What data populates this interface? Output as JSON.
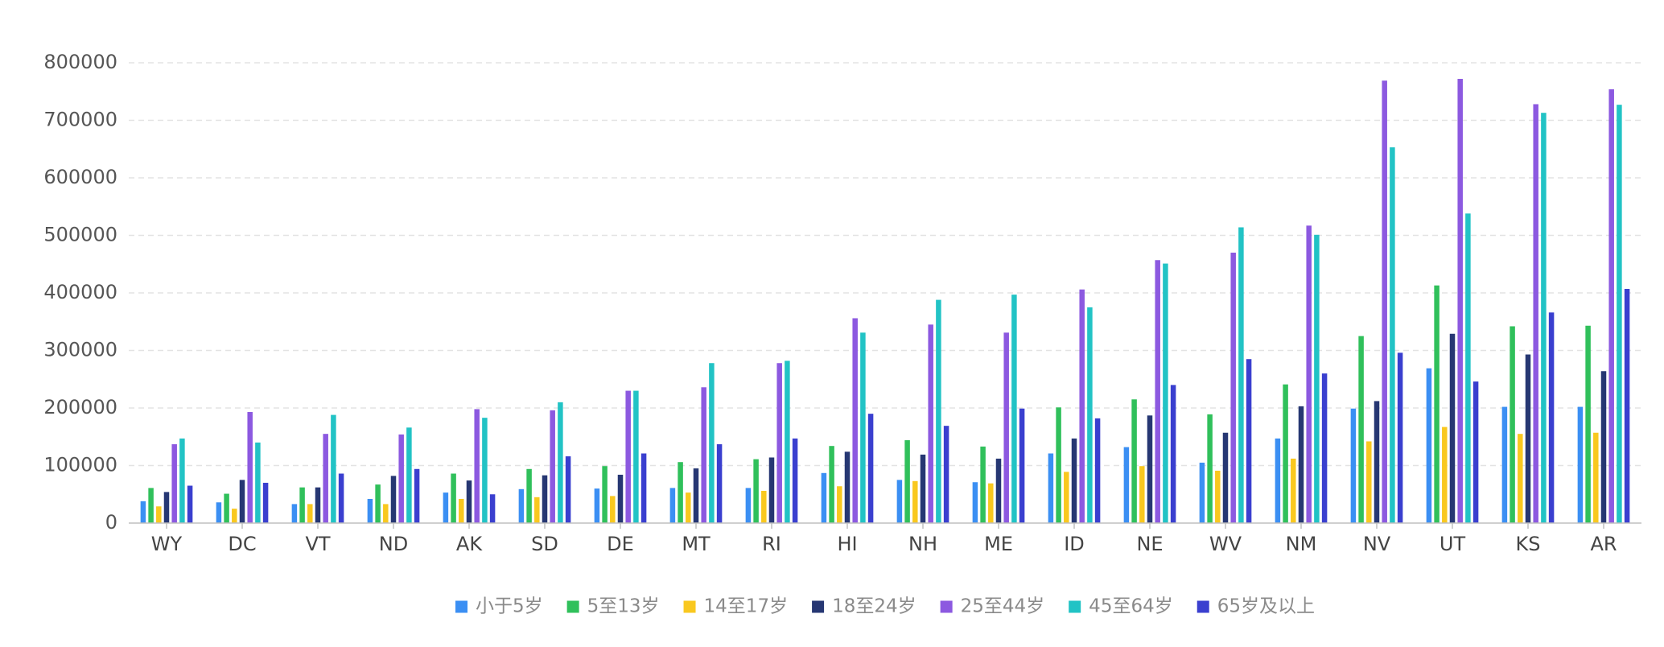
{
  "chart_data": {
    "type": "bar",
    "title": "",
    "xlabel": "",
    "ylabel": "",
    "ylim": [
      0,
      800000
    ],
    "yticks": [
      0,
      100000,
      200000,
      300000,
      400000,
      500000,
      600000,
      700000,
      800000
    ],
    "grid": "horizontal-dashed",
    "legend": "bottom-center",
    "categories": [
      "WY",
      "DC",
      "VT",
      "ND",
      "AK",
      "SD",
      "DE",
      "MT",
      "RI",
      "HI",
      "NH",
      "ME",
      "ID",
      "NE",
      "WV",
      "NM",
      "NV",
      "UT",
      "KS",
      "AR"
    ],
    "series": [
      {
        "name": "小于5岁",
        "color": "#3b8ff3",
        "values": [
          38000,
          36000,
          33000,
          42000,
          53000,
          59000,
          60000,
          61000,
          61000,
          87000,
          75000,
          71000,
          121000,
          132000,
          105000,
          147000,
          199000,
          269000,
          202000,
          202000
        ]
      },
      {
        "name": "5至13岁",
        "color": "#30c05b",
        "values": [
          61000,
          51000,
          62000,
          67000,
          86000,
          94000,
          99000,
          106000,
          111000,
          134000,
          144000,
          133000,
          201000,
          215000,
          189000,
          241000,
          325000,
          413000,
          342000,
          343000
        ]
      },
      {
        "name": "14至17岁",
        "color": "#f9c81f",
        "values": [
          29000,
          25000,
          33000,
          33000,
          42000,
          45000,
          47000,
          53000,
          56000,
          64000,
          73000,
          69000,
          89000,
          99000,
          91000,
          112000,
          142000,
          167000,
          155000,
          157000
        ]
      },
      {
        "name": "18至24岁",
        "color": "#263773",
        "values": [
          54000,
          75000,
          62000,
          82000,
          74000,
          83000,
          84000,
          95000,
          114000,
          124000,
          119000,
          112000,
          147000,
          187000,
          157000,
          203000,
          212000,
          329000,
          293000,
          264000
        ]
      },
      {
        "name": "25至44岁",
        "color": "#8c59e0",
        "values": [
          137000,
          193000,
          155000,
          154000,
          198000,
          196000,
          230000,
          236000,
          278000,
          356000,
          345000,
          331000,
          406000,
          457000,
          470000,
          517000,
          769000,
          772000,
          728000,
          754000
        ]
      },
      {
        "name": "45至64岁",
        "color": "#22c3c5",
        "values": [
          147000,
          140000,
          188000,
          166000,
          183000,
          210000,
          230000,
          278000,
          282000,
          331000,
          388000,
          397000,
          375000,
          451000,
          514000,
          501000,
          653000,
          538000,
          713000,
          727000
        ]
      },
      {
        "name": "65岁及以上",
        "color": "#3a3fcf",
        "values": [
          65000,
          70000,
          86000,
          94000,
          50000,
          116000,
          121000,
          137000,
          147000,
          190000,
          169000,
          199000,
          182000,
          240000,
          285000,
          260000,
          296000,
          246000,
          366000,
          407000
        ]
      }
    ]
  }
}
